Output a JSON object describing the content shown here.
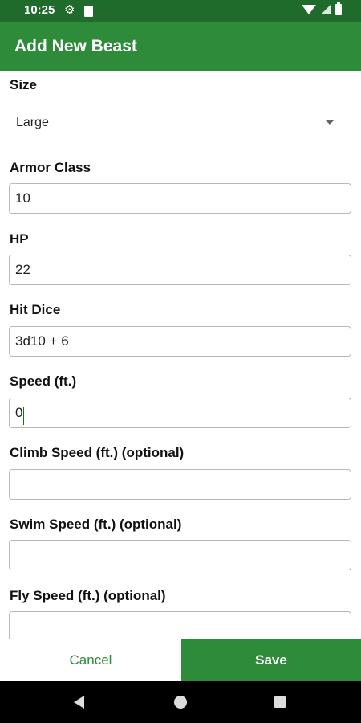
{
  "status_bar": {
    "time": "10:25"
  },
  "app_bar": {
    "title": "Add New Beast"
  },
  "form": {
    "size": {
      "label": "Size",
      "value": "Large"
    },
    "armor_class": {
      "label": "Armor Class",
      "value": "10"
    },
    "hp": {
      "label": "HP",
      "value": "22"
    },
    "hit_dice": {
      "label": "Hit Dice",
      "value": "3d10 + 6"
    },
    "speed": {
      "label": "Speed (ft.)",
      "value": "0"
    },
    "climb_speed": {
      "label": "Climb Speed (ft.) (optional)",
      "value": ""
    },
    "swim_speed": {
      "label": "Swim Speed (ft.) (optional)",
      "value": ""
    },
    "fly_speed": {
      "label": "Fly Speed (ft.) (optional)",
      "value": ""
    }
  },
  "actions": {
    "cancel": "Cancel",
    "save": "Save"
  },
  "colors": {
    "primary": "#2e8b3a",
    "status_bar": "#1f6b2c"
  }
}
